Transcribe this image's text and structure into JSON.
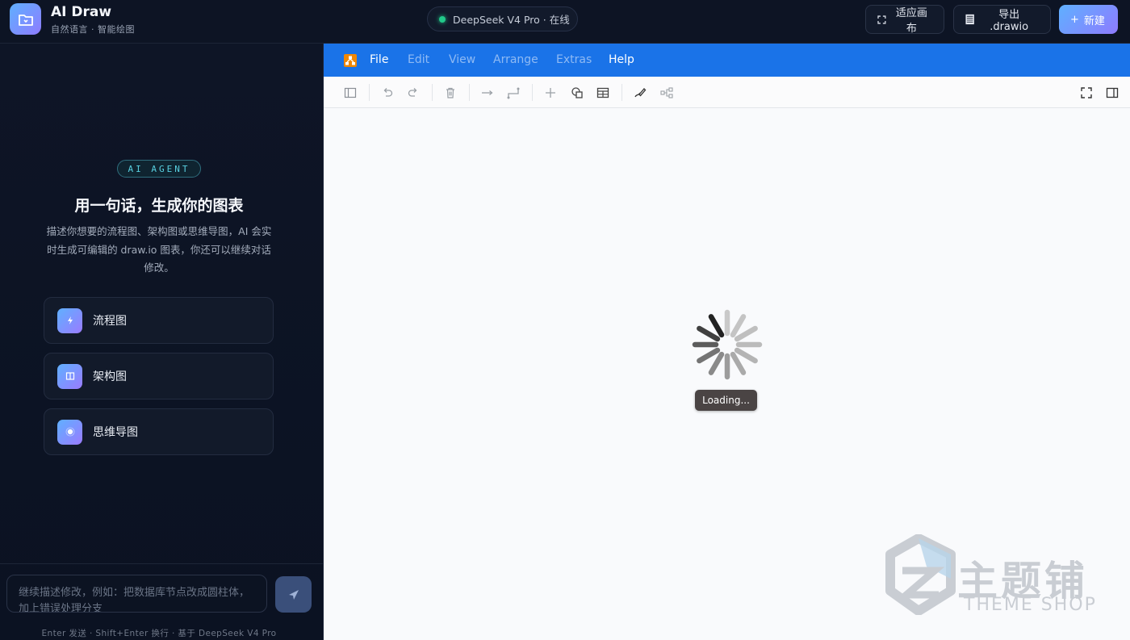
{
  "header": {
    "app_title": "AI Draw",
    "app_subtitle": "自然语言 · 智能绘图",
    "model_status": "DeepSeek V4 Pro · 在线",
    "fit_label": "适应画布",
    "export_label": "导出 .drawio",
    "new_label": "新建",
    "accent_color": "#8e7bff"
  },
  "sidebar": {
    "badge": "AI AGENT",
    "title": "用一句话，生成你的图表",
    "description": "描述你想要的流程图、架构图或思维导图，AI 会实时生成可编辑的 draw.io 图表，你还可以继续对话修改。",
    "cards": [
      {
        "icon": "flowchart-icon",
        "label": "流程图"
      },
      {
        "icon": "architecture-icon",
        "label": "架构图"
      },
      {
        "icon": "mindmap-icon",
        "label": "思维导图"
      }
    ],
    "input_placeholder": "继续描述修改，例如：把数据库节点改成圆柱体，加上错误处理分支",
    "hint": "Enter 发送 · Shift+Enter 换行 · 基于 DeepSeek V4 Pro"
  },
  "editor": {
    "menu": [
      "File",
      "Edit",
      "View",
      "Arrange",
      "Extras",
      "Help"
    ],
    "menu_color": "#1a73e8",
    "loading_text": "Loading..."
  },
  "watermark": {
    "cn": "主题铺",
    "en": "THEME SHOP"
  }
}
